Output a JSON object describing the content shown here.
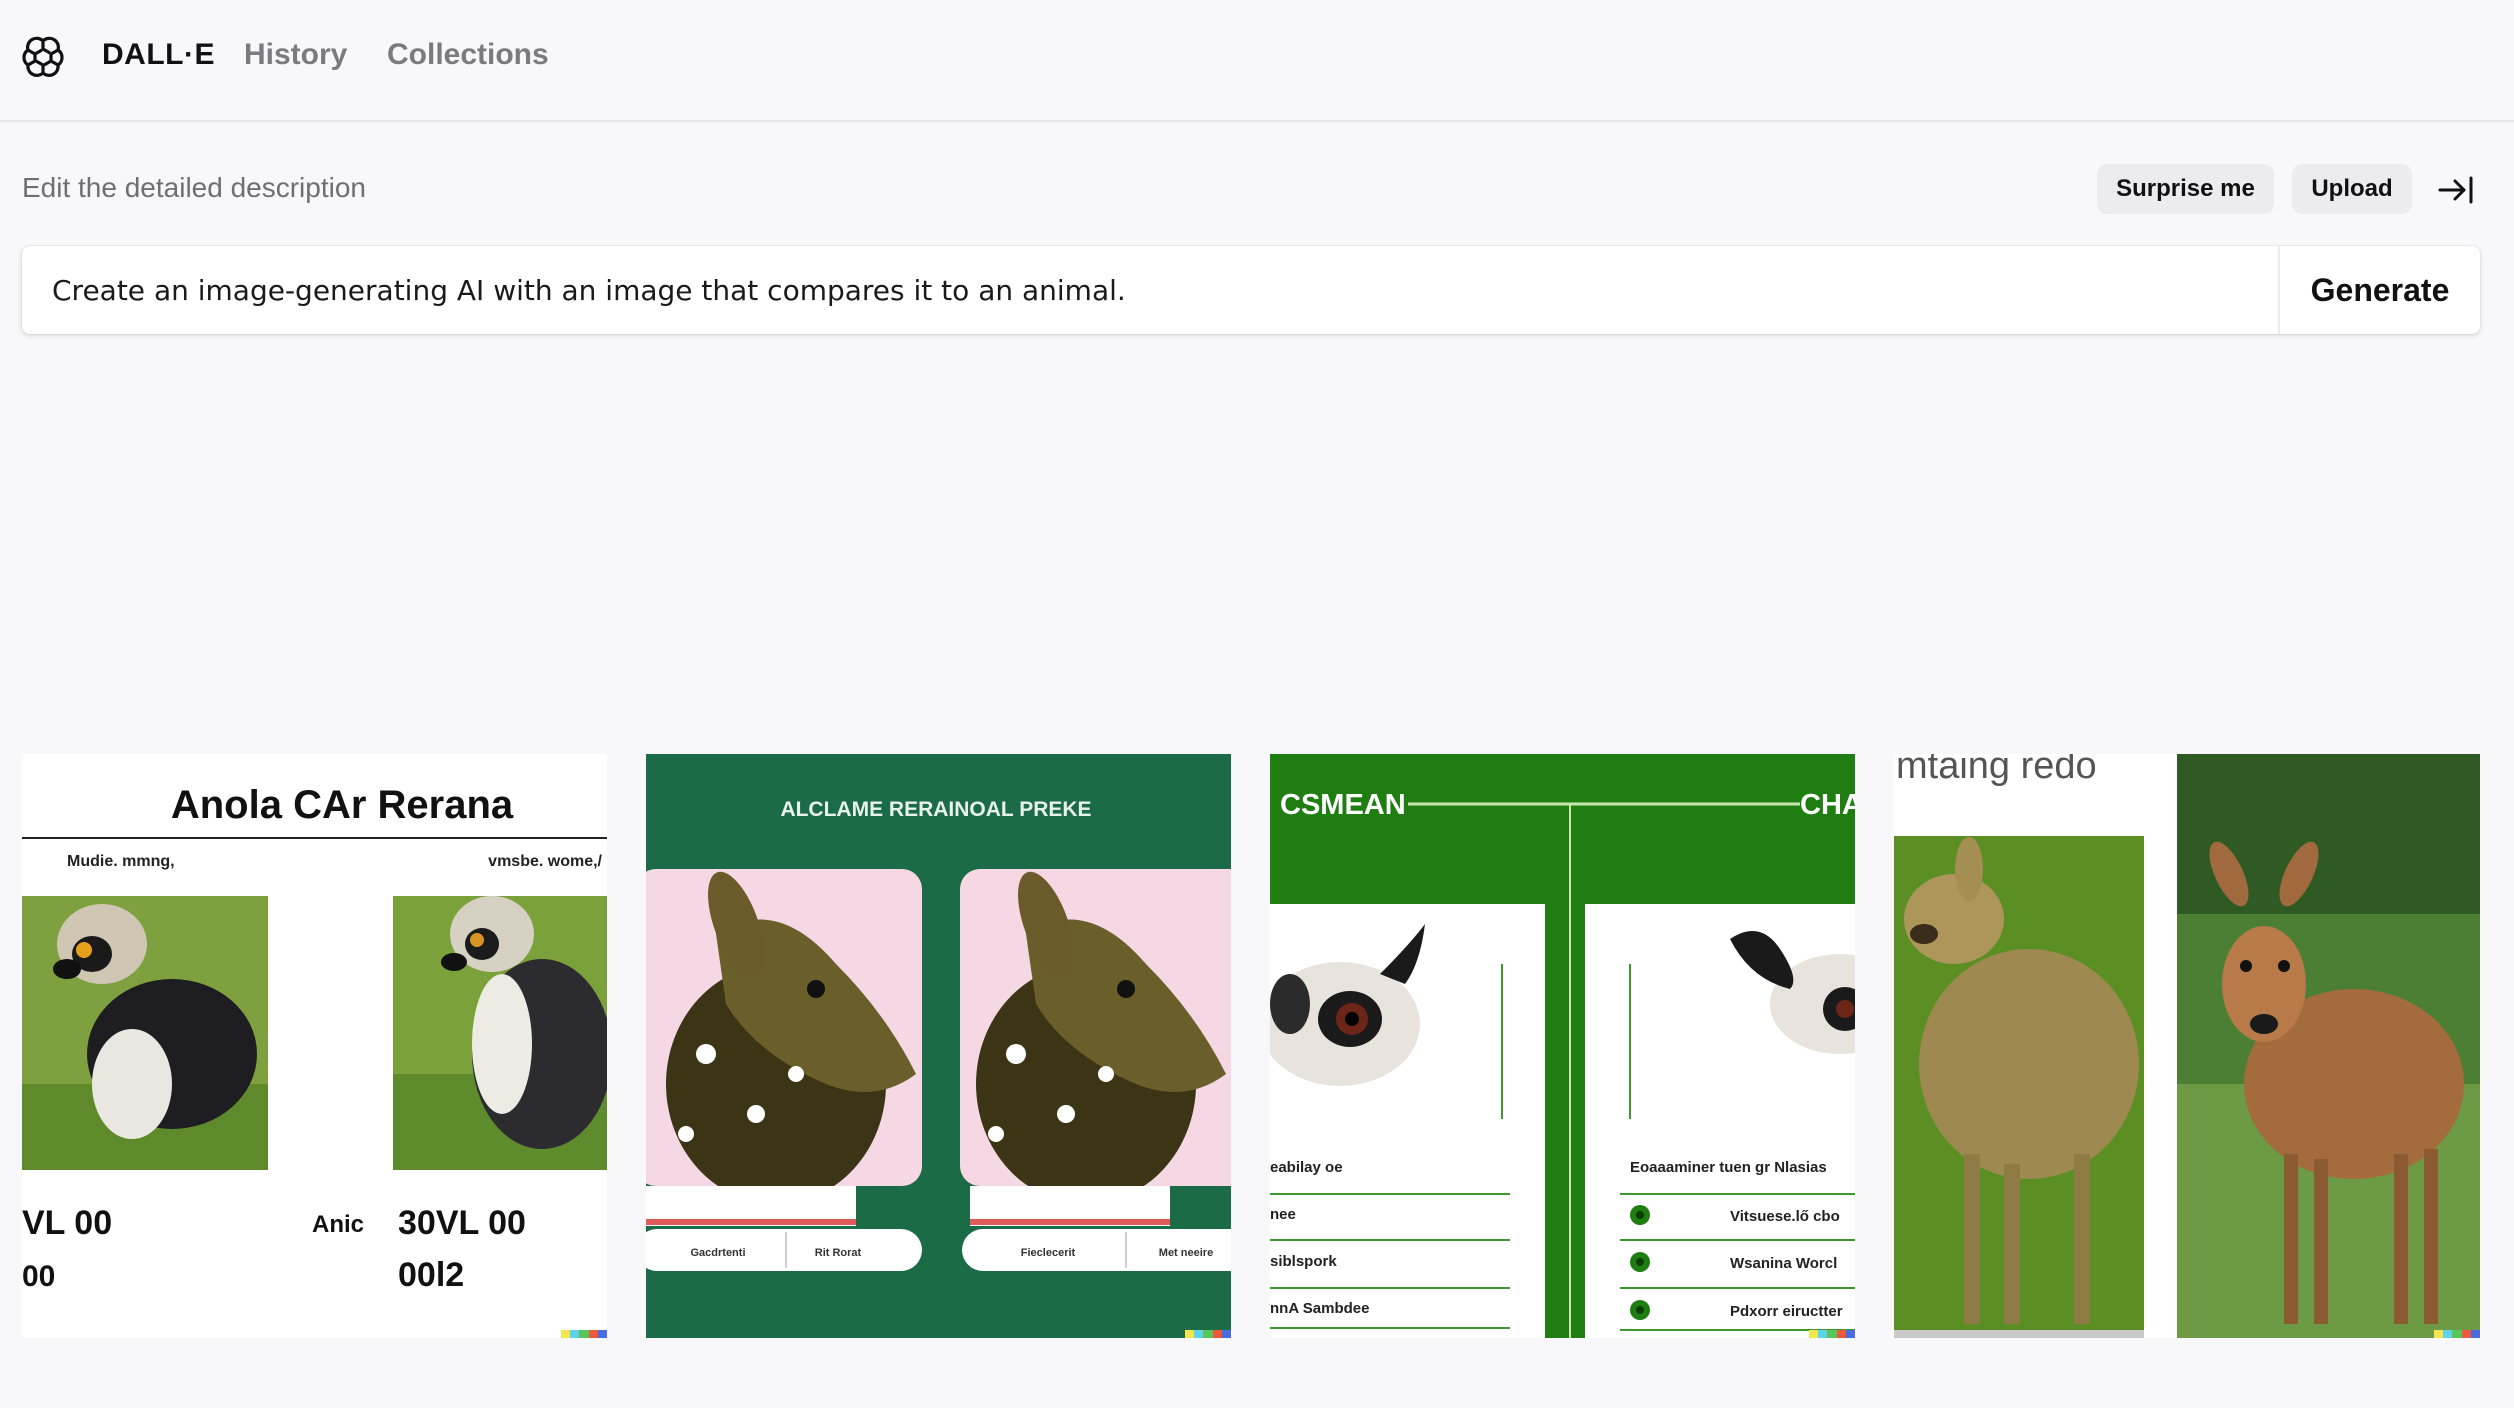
{
  "header": {
    "brand": "DALL·E",
    "nav": {
      "history": "History",
      "collections": "Collections"
    }
  },
  "prompt_section": {
    "label": "Edit the detailed description",
    "surprise_label": "Surprise me",
    "upload_label": "Upload",
    "prompt_value": "Create an image-generating AI with an image that compares it to an animal.",
    "generate_label": "Generate"
  },
  "images": [
    {
      "title": "Anola CAr Rerana",
      "sub_left": "Mudie. mmng,",
      "sub_right": "vmsbe. wome,/",
      "bottom_left_1": "VL 00",
      "bottom_left_2": "00",
      "bottom_mid": "Anic",
      "bottom_right_1": "30VL 00",
      "bottom_right_2": "00l2"
    },
    {
      "title": "ALCLAME RERAINOAL PREKE",
      "btn_left_1": "Gacdrtenti",
      "btn_left_2": "Rit Rorat",
      "btn_right_1": "Fieclecerit",
      "btn_right_2": "Met neeire"
    },
    {
      "title_left": "CSMEAN",
      "title_right": "CHA",
      "left_rows": [
        "eabilay oe",
        "nee",
        "siblspork",
        "nnA Sambdee"
      ],
      "right_header": "Eoaaaminer tuen gr Nlasias",
      "right_rows": [
        "Vitsuese.lő cbo",
        "Wsanina Worcl",
        "Pdxorr eiructter"
      ]
    },
    {
      "caption": "mtaing redo"
    }
  ],
  "colors": {
    "background": "#f8f8fa",
    "green_dark": "#1a6b46",
    "green_bright": "#1f7d12",
    "pill_bg": "#ececef"
  },
  "icons": [
    "openai-logo-icon",
    "collapse-panel-icon"
  ]
}
